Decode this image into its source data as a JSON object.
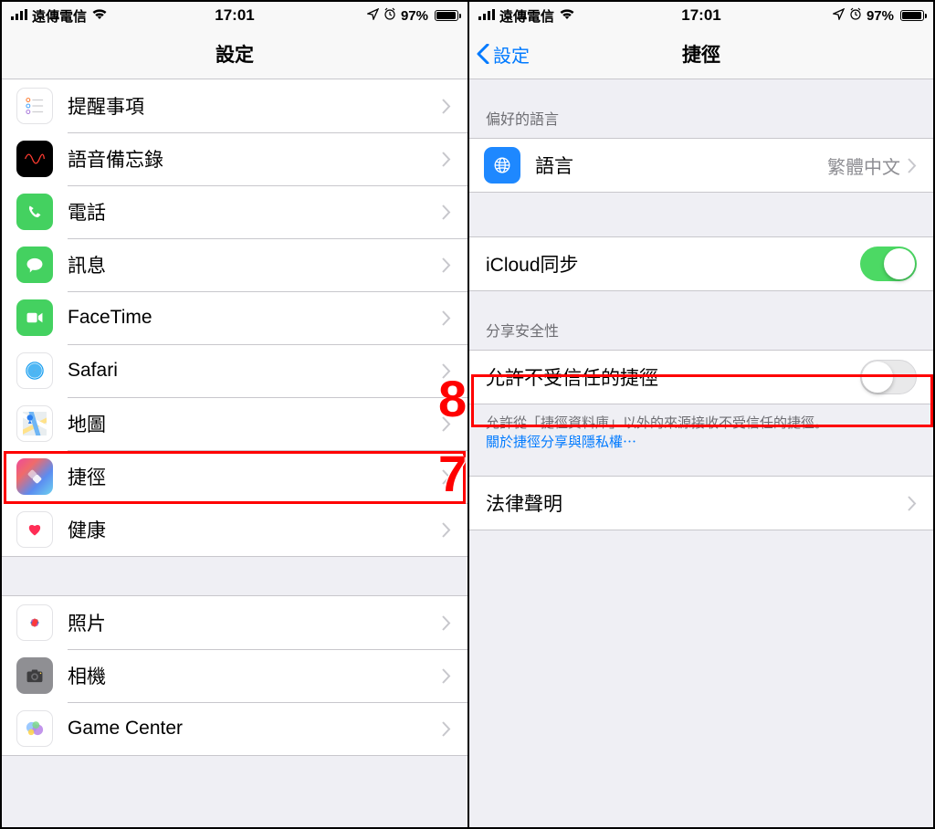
{
  "status": {
    "carrier": "遠傳電信",
    "time": "17:01",
    "battery_pct": "97%"
  },
  "left": {
    "title": "設定",
    "rows": [
      {
        "icon": "reminders-icon",
        "label": "提醒事項"
      },
      {
        "icon": "voice-memos-icon",
        "label": "語音備忘錄"
      },
      {
        "icon": "phone-icon",
        "label": "電話"
      },
      {
        "icon": "messages-icon",
        "label": "訊息"
      },
      {
        "icon": "facetime-icon",
        "label": "FaceTime"
      },
      {
        "icon": "safari-icon",
        "label": "Safari"
      },
      {
        "icon": "maps-icon",
        "label": "地圖"
      },
      {
        "icon": "shortcuts-icon",
        "label": "捷徑"
      },
      {
        "icon": "health-icon",
        "label": "健康"
      }
    ],
    "rows2": [
      {
        "icon": "photos-icon",
        "label": "照片"
      },
      {
        "icon": "camera-icon",
        "label": "相機"
      },
      {
        "icon": "gamecenter-icon",
        "label": "Game Center"
      }
    ]
  },
  "right": {
    "back_label": "設定",
    "title": "捷徑",
    "section_lang_header": "偏好的語言",
    "lang_label": "語言",
    "lang_value": "繁體中文",
    "icloud_label": "iCloud同步",
    "section_sec_header": "分享安全性",
    "untrusted_label": "允許不受信任的捷徑",
    "untrusted_footer1": "允許從「捷徑資料庫」以外的來源接收不受信任的捷徑。",
    "untrusted_footer_link": "關於捷徑分享與隱私權⋯",
    "legal_label": "法律聲明"
  },
  "annotations": {
    "seven": "7",
    "eight": "8"
  }
}
